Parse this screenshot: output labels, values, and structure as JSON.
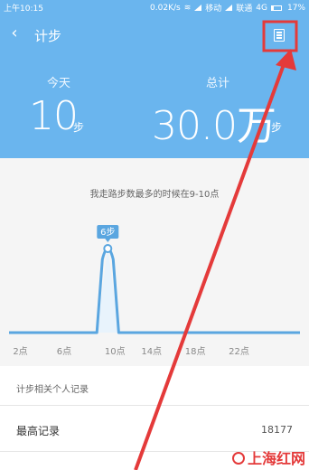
{
  "status_bar": {
    "time": "上午10:15",
    "speed": "0.02K/s",
    "carrier1": "移动",
    "carrier2": "联通",
    "network": "4G",
    "battery": "17%"
  },
  "header": {
    "title": "计步",
    "back_icon": "chevron-left-icon",
    "menu_icon": "list-icon"
  },
  "summary": {
    "today_label": "今天",
    "today_value": "10",
    "today_unit": "步",
    "total_label": "总计",
    "total_value": "30.0万",
    "total_unit": "步"
  },
  "chart_caption": "我走路步数最多的时候在9-10点",
  "chart_data": {
    "type": "area",
    "x_ticks": [
      "2点",
      "6点",
      "10点",
      "14点",
      "18点",
      "22点"
    ],
    "x": [
      0,
      9,
      10,
      11,
      24
    ],
    "y": [
      0,
      0,
      6,
      0,
      0
    ],
    "peak_label": "6步",
    "peak_hour": 10,
    "xlim": [
      0,
      24
    ],
    "ylim": [
      0,
      6
    ]
  },
  "records": {
    "header": "计步相关个人记录",
    "items": [
      {
        "label": "最高记录",
        "value": "18177"
      }
    ]
  },
  "watermark": "上海红网",
  "colors": {
    "header_bg": "#6ab5ee",
    "chart_line": "#5aa6e0",
    "chart_fill": "#e8f3fc",
    "annotation": "#e43a3a"
  }
}
